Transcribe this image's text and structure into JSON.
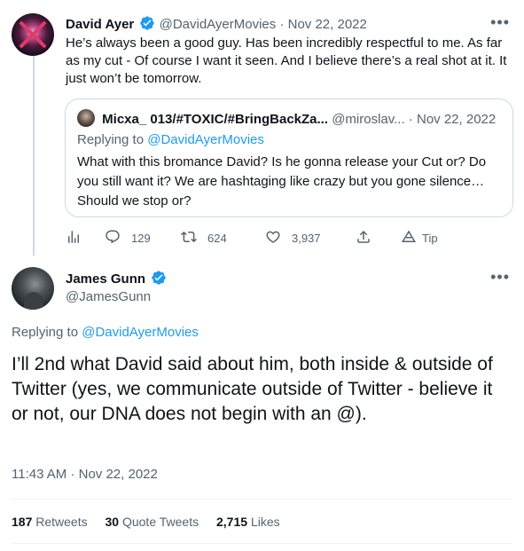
{
  "parent_tweet": {
    "author_name": "David Ayer",
    "handle": "@DavidAyerMovies",
    "separator": "·",
    "date": "Nov 22, 2022",
    "text": "He’s always been a good guy. Has been incredibly respectful to me. As far as my cut - Of course I want it seen. And I believe there’s a real shot at it. It just won’t be tomorrow.",
    "quote": {
      "author_name": "Micxa_ 013/#TOXIC/#BringBackZa...",
      "handle": "@miroslav...",
      "separator": "·",
      "date": "Nov 22, 2022",
      "replying_prefix": "Replying to",
      "replying_to": "@DavidAyerMovies",
      "text": "What with this bromance David? Is he gonna release your Cut or? Do you still want it? We are hashtaging like crazy but you gone silence… Should we stop or?"
    },
    "actions": {
      "replies": "129",
      "retweets": "624",
      "likes": "3,937",
      "tip_label": "Tip"
    }
  },
  "main_tweet": {
    "author_name": "James Gunn",
    "handle": "@JamesGunn",
    "replying_prefix": "Replying to",
    "replying_to": "@DavidAyerMovies",
    "text": "I’ll 2nd what David said about him, both inside & outside of Twitter (yes, we communicate outside of Twitter - believe it or not, our DNA does not begin with an @).",
    "time": "11:43 AM",
    "separator": "·",
    "date": "Nov 22, 2022",
    "stats": {
      "retweets_count": "187",
      "retweets_label": "Retweets",
      "quotes_count": "30",
      "quotes_label": "Quote Tweets",
      "likes_count": "2,715",
      "likes_label": "Likes"
    }
  },
  "icons": {
    "verified": "verified-badge-icon",
    "more": "more-options-icon",
    "analytics": "analytics-icon",
    "reply": "reply-icon",
    "retweet": "retweet-icon",
    "like": "heart-icon",
    "share": "share-icon",
    "tip": "tip-icon"
  },
  "colors": {
    "accent": "#1d9bf0",
    "muted_text": "#536471",
    "primary_text": "#0f1419",
    "border": "#cfd9de"
  }
}
